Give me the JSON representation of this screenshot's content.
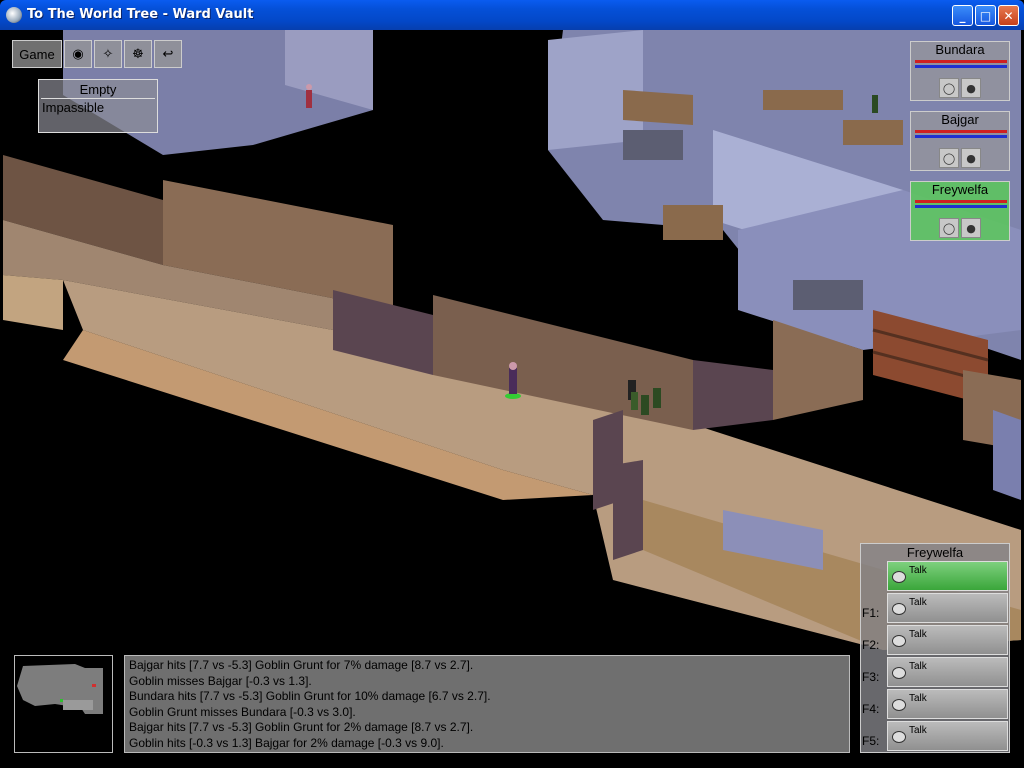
{
  "window": {
    "title": "To The World Tree - Ward Vault"
  },
  "toolbar": {
    "game_label": "Game"
  },
  "tile_info": {
    "title": "Empty",
    "detail": "Impassible"
  },
  "party": [
    {
      "name": "Bundara",
      "hp": 1.0,
      "mp": 1.0,
      "active": false
    },
    {
      "name": "Bajgar",
      "hp": 1.0,
      "mp": 1.0,
      "active": false
    },
    {
      "name": "Freywelfa",
      "hp": 1.0,
      "mp": 1.0,
      "active": true
    }
  ],
  "talk_panel": {
    "name": "Freywelfa",
    "rows": [
      {
        "key": "",
        "label": "Talk"
      },
      {
        "key": "F1:",
        "label": "Talk"
      },
      {
        "key": "F2:",
        "label": "Talk"
      },
      {
        "key": "F3:",
        "label": "Talk"
      },
      {
        "key": "F4:",
        "label": "Talk"
      },
      {
        "key": "F5:",
        "label": "Talk"
      }
    ]
  },
  "combat_log": [
    "Bajgar hits [7.7 vs -5.3] Goblin Grunt for 7% damage [8.7 vs 2.7].",
    "Goblin misses Bajgar [-0.3 vs 1.3].",
    "Bundara hits [7.7 vs -5.3] Goblin Grunt for 10% damage [6.7 vs 2.7].",
    "Goblin Grunt misses Bundara [-0.3 vs 3.0].",
    "Bajgar hits [7.7 vs -5.3] Goblin Grunt for 2% damage [8.7 vs 2.7].",
    "Goblin hits [-0.3 vs 1.3] Bajgar for 2% damage [-0.3 vs 9.0]."
  ]
}
